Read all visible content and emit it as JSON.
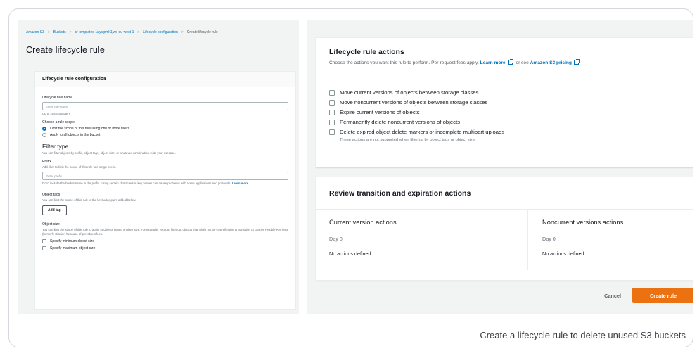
{
  "left_panel": {
    "breadcrumbs": [
      "Amazon S3",
      "Buckets",
      "cf-templates-1aysgfmk1jws-eu-west-1",
      "Lifecycle configuration",
      "Create lifecycle rule"
    ],
    "page_title": "Create lifecycle rule",
    "config_title": "Lifecycle rule configuration",
    "rule_name_label": "Lifecycle rule name",
    "rule_name_placeholder": "Enter rule name",
    "rule_name_hint": "Up to 255 characters",
    "scope_label": "Choose a rule scope",
    "scope_options": [
      "Limit the scope of this rule using one or more filters",
      "Apply to all objects in the bucket"
    ],
    "filter_title": "Filter type",
    "filter_hint": "You can filter objects by prefix, object tags, object size, or whatever combination suits your usecase.",
    "prefix_label": "Prefix",
    "prefix_hint": "Add filter to limit the scope of this rule to a single prefix.",
    "prefix_placeholder": "Enter prefix",
    "prefix_note": "Don't include the bucket name in the prefix. Using certain characters in key names can cause problems with some applications and protocols.",
    "learn_more": "Learn more",
    "tags_label": "Object tags",
    "tags_hint": "You can limit the scope of this rule to the key/value pairs added below.",
    "add_tag": "Add tag",
    "size_label": "Object size",
    "size_hint": "You can limit the scope of this rule to apply to objects based on their size. For example, you can filter out objects that might not be cost effective to transition to Glacier Flexible Retrieval (formerly Glacier) because of per-object fees.",
    "size_options": [
      "Specify minimum object size",
      "Specify maximum object size"
    ]
  },
  "actions_card": {
    "title": "Lifecycle rule actions",
    "subtitle": "Choose the actions you want this rule to perform. Per-request fees apply.",
    "learn_more": "Learn more",
    "or_see": "or see",
    "pricing_link": "Amazon S3 pricing",
    "actions": [
      "Move current versions of objects between storage classes",
      "Move noncurrent versions of objects between storage classes",
      "Expire current versions of objects",
      "Permanently delete noncurrent versions of objects",
      "Delete expired object delete markers or incomplete multipart uploads"
    ],
    "note": "These actions are not supported when filtering by object tags or object size."
  },
  "review_card": {
    "title": "Review transition and expiration actions",
    "current": {
      "title": "Current version actions",
      "day": "Day 0",
      "status": "No actions defined."
    },
    "noncurrent": {
      "title": "Noncurrent versions actions",
      "day": "Day 0",
      "status": "No actions defined."
    }
  },
  "footer": {
    "cancel": "Cancel",
    "create": "Create rule"
  },
  "caption": "Create a lifecycle rule to delete unused S3 buckets",
  "colors": {
    "accent": "#ec7211",
    "link": "#0073bb",
    "panel_bg": "#f2f3f3"
  }
}
